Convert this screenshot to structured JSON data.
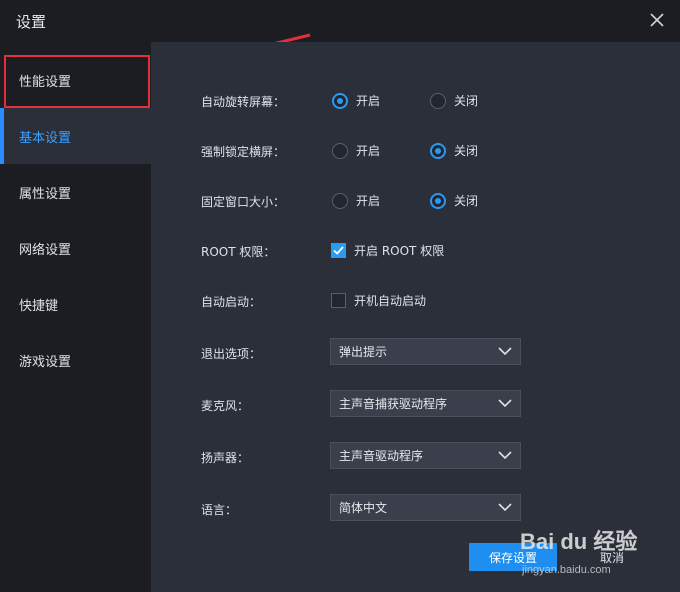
{
  "window": {
    "title": "设置"
  },
  "sidebar": {
    "items": [
      {
        "label": "性能设置"
      },
      {
        "label": "基本设置"
      },
      {
        "label": "属性设置"
      },
      {
        "label": "网络设置"
      },
      {
        "label": "快捷键"
      },
      {
        "label": "游戏设置"
      }
    ],
    "active": "基本设置"
  },
  "settings": {
    "auto_rotate": {
      "label": "自动旋转屏幕：",
      "on": "开启",
      "off": "关闭",
      "value": "开启"
    },
    "force_landscape": {
      "label": "强制锁定横屏：",
      "on": "开启",
      "off": "关闭",
      "value": "关闭"
    },
    "fixed_window": {
      "label": "固定窗口大小：",
      "on": "开启",
      "off": "关闭",
      "value": "关闭"
    },
    "root": {
      "label": "ROOT 权限：",
      "option": "开启 ROOT 权限",
      "checked": true
    },
    "autostart": {
      "label": "自动启动：",
      "option": "开机自动启动",
      "checked": false
    },
    "exit_option": {
      "label": "退出选项：",
      "value": "弹出提示"
    },
    "microphone": {
      "label": "麦克风：",
      "value": "主声音捕获驱动程序"
    },
    "speaker": {
      "label": "扬声器：",
      "value": "主声音驱动程序"
    },
    "language": {
      "label": "语言：",
      "value": "简体中文"
    }
  },
  "buttons": {
    "save": "保存设置",
    "cancel": "取消"
  },
  "watermark": {
    "main": "Bai du 经验",
    "sub": "jingyan.baidu.com"
  },
  "colors": {
    "accent": "#2b9af3",
    "highlight": "#e0313b",
    "panel": "#2b2f3a",
    "sidebar": "#1b1d23"
  },
  "icons": {
    "close": "close-icon",
    "chevron": "chevron-down-icon",
    "check": "check-icon"
  }
}
